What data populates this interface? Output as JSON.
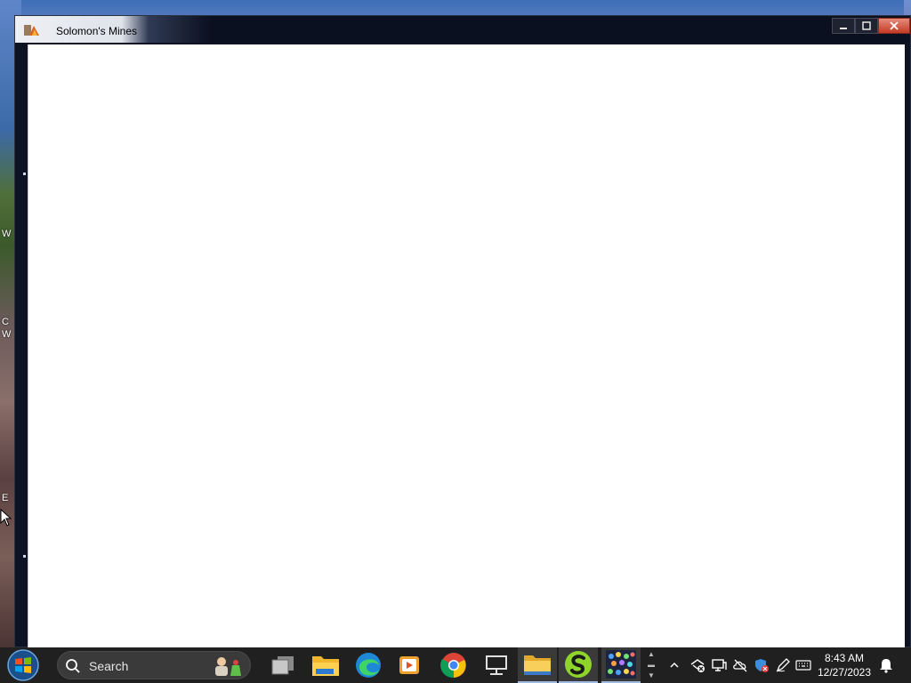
{
  "window": {
    "title": "Solomon's Mines",
    "controls": [
      "minimize-icon",
      "maximize-icon",
      "close-icon"
    ]
  },
  "desktop": {
    "partial_labels": [
      "W",
      "C",
      "W",
      "E"
    ]
  },
  "taskbar": {
    "start_icon": "windows-logo-icon",
    "search": {
      "label": "Search"
    },
    "apps": [
      {
        "name": "task-view",
        "icon": "task-view-icon"
      },
      {
        "name": "file-explorer",
        "icon": "folder-icon"
      },
      {
        "name": "edge",
        "icon": "edge-icon"
      },
      {
        "name": "media-player",
        "icon": "media-player-icon"
      },
      {
        "name": "chrome",
        "icon": "chrome-icon"
      },
      {
        "name": "remote-desktop",
        "icon": "monitor-icon"
      },
      {
        "name": "folder-window",
        "icon": "folder-icon"
      },
      {
        "name": "s-app",
        "icon": "s-logo-icon"
      },
      {
        "name": "dots-app",
        "icon": "dots-grid-icon"
      }
    ]
  },
  "tray": {
    "icons": [
      "chevron-up-icon",
      "network-off-icon",
      "display-icon",
      "cloud-off-icon",
      "shield-icon",
      "pen-icon",
      "keyboard-icon"
    ],
    "time": "8:43 AM",
    "date": "12/27/2023",
    "notification_icon": "bell-icon"
  },
  "colors": {
    "taskbar": "#202020",
    "title_active": "#0b1020",
    "close_button": "#c43b24"
  }
}
